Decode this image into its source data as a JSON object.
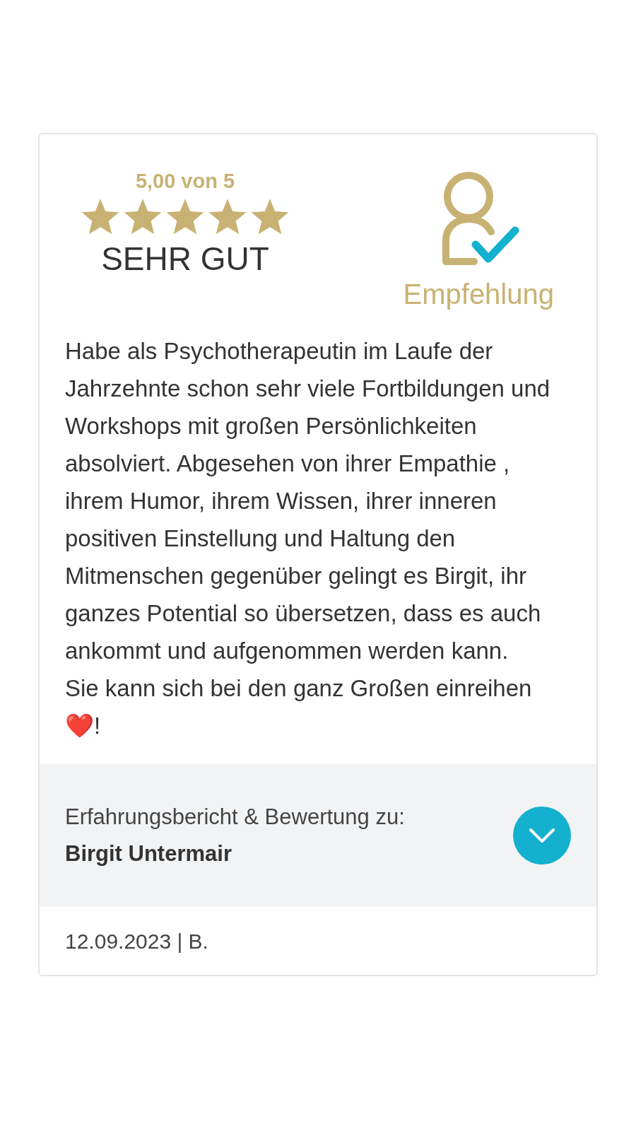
{
  "rating": {
    "score": "5,00 von 5",
    "stars": 5,
    "verdict": "SEHR GUT"
  },
  "recommendation": {
    "label": "Empfehlung"
  },
  "review": {
    "paragraphs": [
      "Habe als Psychotherapeutin im Laufe der Jahrzehnte schon sehr viele Fortbildungen und Workshops mit großen Persönlichkeiten absolviert. Abgesehen von ihrer Empathie , ihrem Humor, ihrem Wissen, ihrer inneren positiven Einstellung und Haltung den Mitmenschen gegenüber gelingt es Birgit, ihr ganzes Potential so übersetzen, dass es auch ankommt und aufgenommen werden kann.",
      "Sie kann sich bei den ganz Großen einreihen ❤️!"
    ]
  },
  "subject": {
    "caption": "Erfahrungsbericht & Bewertung zu:",
    "name": "Birgit Untermair",
    "expanded": false
  },
  "footer": {
    "meta": "12.09.2023 | B."
  }
}
